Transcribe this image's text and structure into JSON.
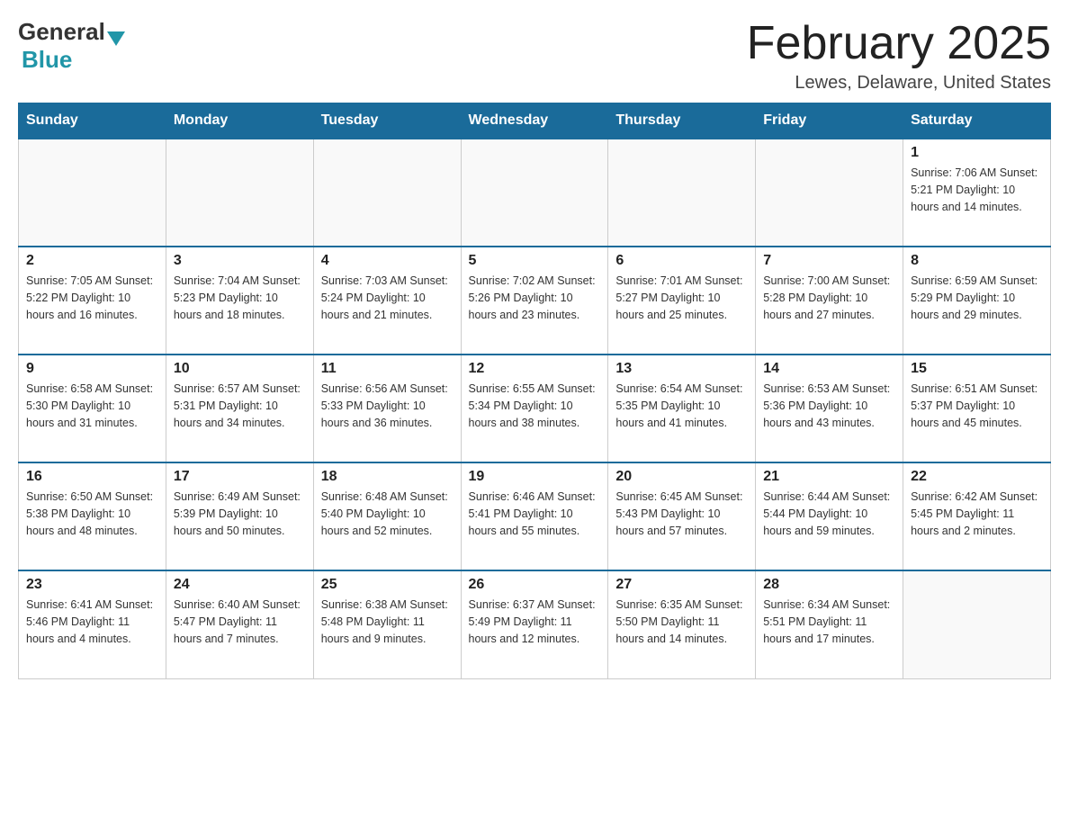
{
  "header": {
    "logo_general": "General",
    "logo_blue": "Blue",
    "month_title": "February 2025",
    "location": "Lewes, Delaware, United States"
  },
  "weekdays": [
    "Sunday",
    "Monday",
    "Tuesday",
    "Wednesday",
    "Thursday",
    "Friday",
    "Saturday"
  ],
  "weeks": [
    [
      {
        "day": "",
        "info": ""
      },
      {
        "day": "",
        "info": ""
      },
      {
        "day": "",
        "info": ""
      },
      {
        "day": "",
        "info": ""
      },
      {
        "day": "",
        "info": ""
      },
      {
        "day": "",
        "info": ""
      },
      {
        "day": "1",
        "info": "Sunrise: 7:06 AM\nSunset: 5:21 PM\nDaylight: 10 hours\nand 14 minutes."
      }
    ],
    [
      {
        "day": "2",
        "info": "Sunrise: 7:05 AM\nSunset: 5:22 PM\nDaylight: 10 hours\nand 16 minutes."
      },
      {
        "day": "3",
        "info": "Sunrise: 7:04 AM\nSunset: 5:23 PM\nDaylight: 10 hours\nand 18 minutes."
      },
      {
        "day": "4",
        "info": "Sunrise: 7:03 AM\nSunset: 5:24 PM\nDaylight: 10 hours\nand 21 minutes."
      },
      {
        "day": "5",
        "info": "Sunrise: 7:02 AM\nSunset: 5:26 PM\nDaylight: 10 hours\nand 23 minutes."
      },
      {
        "day": "6",
        "info": "Sunrise: 7:01 AM\nSunset: 5:27 PM\nDaylight: 10 hours\nand 25 minutes."
      },
      {
        "day": "7",
        "info": "Sunrise: 7:00 AM\nSunset: 5:28 PM\nDaylight: 10 hours\nand 27 minutes."
      },
      {
        "day": "8",
        "info": "Sunrise: 6:59 AM\nSunset: 5:29 PM\nDaylight: 10 hours\nand 29 minutes."
      }
    ],
    [
      {
        "day": "9",
        "info": "Sunrise: 6:58 AM\nSunset: 5:30 PM\nDaylight: 10 hours\nand 31 minutes."
      },
      {
        "day": "10",
        "info": "Sunrise: 6:57 AM\nSunset: 5:31 PM\nDaylight: 10 hours\nand 34 minutes."
      },
      {
        "day": "11",
        "info": "Sunrise: 6:56 AM\nSunset: 5:33 PM\nDaylight: 10 hours\nand 36 minutes."
      },
      {
        "day": "12",
        "info": "Sunrise: 6:55 AM\nSunset: 5:34 PM\nDaylight: 10 hours\nand 38 minutes."
      },
      {
        "day": "13",
        "info": "Sunrise: 6:54 AM\nSunset: 5:35 PM\nDaylight: 10 hours\nand 41 minutes."
      },
      {
        "day": "14",
        "info": "Sunrise: 6:53 AM\nSunset: 5:36 PM\nDaylight: 10 hours\nand 43 minutes."
      },
      {
        "day": "15",
        "info": "Sunrise: 6:51 AM\nSunset: 5:37 PM\nDaylight: 10 hours\nand 45 minutes."
      }
    ],
    [
      {
        "day": "16",
        "info": "Sunrise: 6:50 AM\nSunset: 5:38 PM\nDaylight: 10 hours\nand 48 minutes."
      },
      {
        "day": "17",
        "info": "Sunrise: 6:49 AM\nSunset: 5:39 PM\nDaylight: 10 hours\nand 50 minutes."
      },
      {
        "day": "18",
        "info": "Sunrise: 6:48 AM\nSunset: 5:40 PM\nDaylight: 10 hours\nand 52 minutes."
      },
      {
        "day": "19",
        "info": "Sunrise: 6:46 AM\nSunset: 5:41 PM\nDaylight: 10 hours\nand 55 minutes."
      },
      {
        "day": "20",
        "info": "Sunrise: 6:45 AM\nSunset: 5:43 PM\nDaylight: 10 hours\nand 57 minutes."
      },
      {
        "day": "21",
        "info": "Sunrise: 6:44 AM\nSunset: 5:44 PM\nDaylight: 10 hours\nand 59 minutes."
      },
      {
        "day": "22",
        "info": "Sunrise: 6:42 AM\nSunset: 5:45 PM\nDaylight: 11 hours\nand 2 minutes."
      }
    ],
    [
      {
        "day": "23",
        "info": "Sunrise: 6:41 AM\nSunset: 5:46 PM\nDaylight: 11 hours\nand 4 minutes."
      },
      {
        "day": "24",
        "info": "Sunrise: 6:40 AM\nSunset: 5:47 PM\nDaylight: 11 hours\nand 7 minutes."
      },
      {
        "day": "25",
        "info": "Sunrise: 6:38 AM\nSunset: 5:48 PM\nDaylight: 11 hours\nand 9 minutes."
      },
      {
        "day": "26",
        "info": "Sunrise: 6:37 AM\nSunset: 5:49 PM\nDaylight: 11 hours\nand 12 minutes."
      },
      {
        "day": "27",
        "info": "Sunrise: 6:35 AM\nSunset: 5:50 PM\nDaylight: 11 hours\nand 14 minutes."
      },
      {
        "day": "28",
        "info": "Sunrise: 6:34 AM\nSunset: 5:51 PM\nDaylight: 11 hours\nand 17 minutes."
      },
      {
        "day": "",
        "info": ""
      }
    ]
  ]
}
